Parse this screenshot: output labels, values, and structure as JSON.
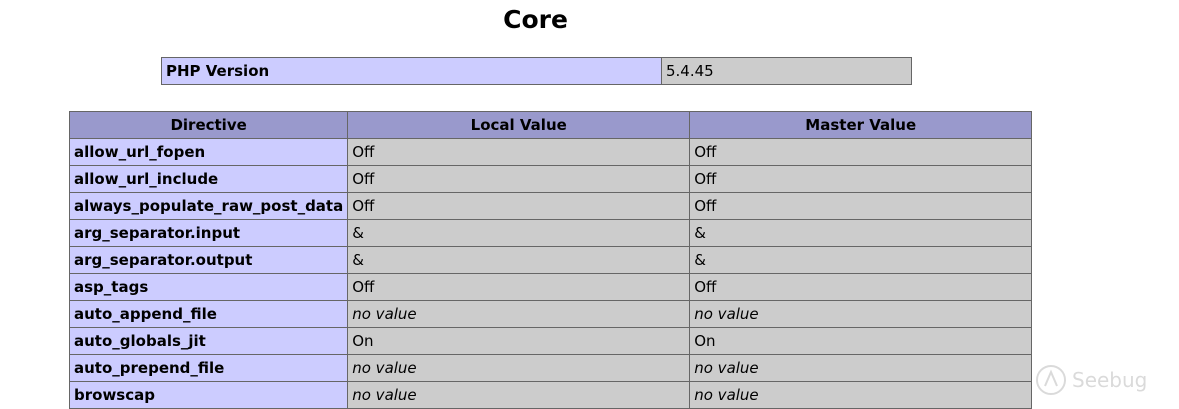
{
  "section": {
    "title": "Core"
  },
  "version": {
    "label": "PHP Version",
    "value": "5.4.45"
  },
  "directives": {
    "headers": [
      "Directive",
      "Local Value",
      "Master Value"
    ],
    "rows": [
      {
        "name": "allow_url_fopen",
        "local": "Off",
        "master": "Off",
        "no_value": false
      },
      {
        "name": "allow_url_include",
        "local": "Off",
        "master": "Off",
        "no_value": false
      },
      {
        "name": "always_populate_raw_post_data",
        "local": "Off",
        "master": "Off",
        "no_value": false
      },
      {
        "name": "arg_separator.input",
        "local": "&",
        "master": "&",
        "no_value": false
      },
      {
        "name": "arg_separator.output",
        "local": "&",
        "master": "&",
        "no_value": false
      },
      {
        "name": "asp_tags",
        "local": "Off",
        "master": "Off",
        "no_value": false
      },
      {
        "name": "auto_append_file",
        "local": "no value",
        "master": "no value",
        "no_value": true
      },
      {
        "name": "auto_globals_jit",
        "local": "On",
        "master": "On",
        "no_value": false
      },
      {
        "name": "auto_prepend_file",
        "local": "no value",
        "master": "no value",
        "no_value": true
      },
      {
        "name": "browscap",
        "local": "no value",
        "master": "no value",
        "no_value": true
      }
    ]
  },
  "watermark": {
    "text": "Seebug",
    "icon": "seebug-logo-icon"
  },
  "colors": {
    "header_bg": "#9999cc",
    "name_bg": "#ccccff",
    "value_bg": "#cccccc",
    "border": "#666666"
  }
}
